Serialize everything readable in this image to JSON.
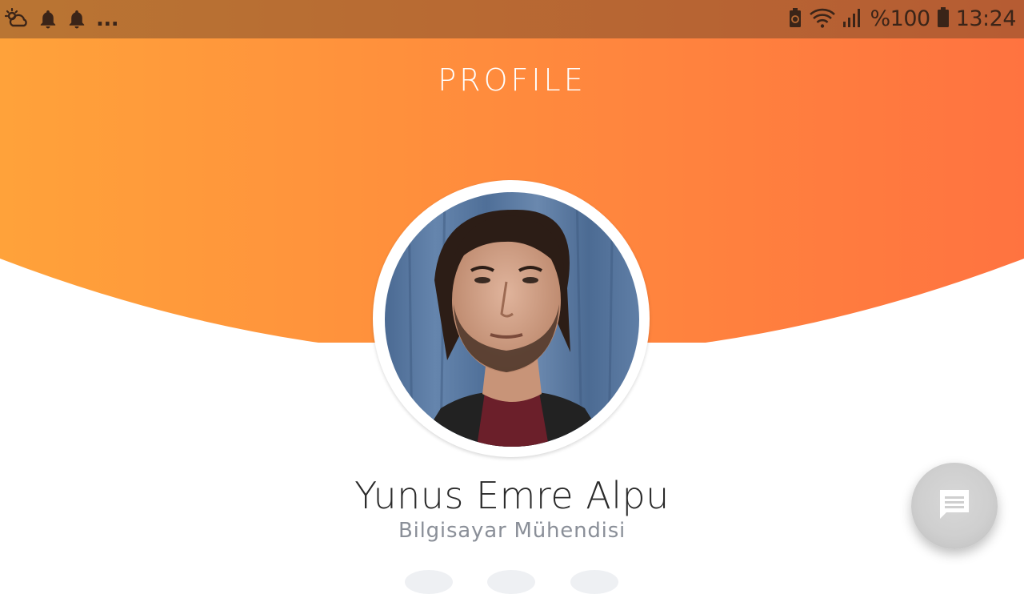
{
  "status_bar": {
    "left_icons": [
      "weather-icon",
      "bell-icon",
      "bell-icon",
      "more-dots-icon"
    ],
    "more_label": "...",
    "right_icons": [
      "battery-saver-icon",
      "wifi-icon",
      "signal-icon",
      "battery-icon"
    ],
    "battery_label": "%100",
    "time": "13:24"
  },
  "header": {
    "title": "PROFILE",
    "gradient_start": "#ffa23a",
    "gradient_end": "#ff7340"
  },
  "profile": {
    "name": "Yunus Emre Alpu",
    "role": "Bilgisayar Mühendisi"
  },
  "fab": {
    "icon": "chat-icon"
  },
  "colors": {
    "status_bar": "#b86a33",
    "name_text": "#2a2a2a",
    "role_text": "#8a8f98"
  }
}
